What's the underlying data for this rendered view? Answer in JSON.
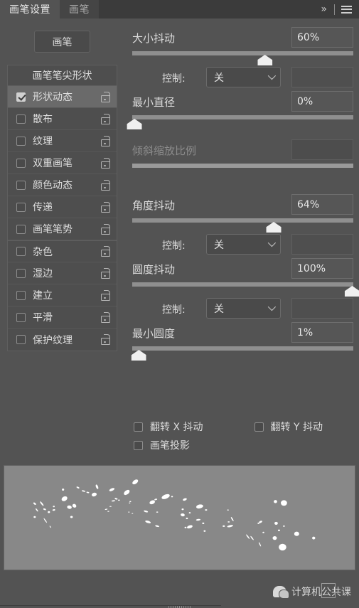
{
  "tabs": {
    "active_label": "画笔设置",
    "inactive_label": "画笔",
    "collapse_label": "»",
    "menu_icon": "hamburger-menu-icon"
  },
  "brush_button": {
    "label": "画笔"
  },
  "sidebar": {
    "header": "画笔笔尖形状",
    "items": [
      {
        "label": "形状动态",
        "checked": true,
        "selected": true,
        "locked": false
      },
      {
        "label": "散布",
        "checked": false,
        "selected": false,
        "locked": false
      },
      {
        "label": "纹理",
        "checked": false,
        "selected": false,
        "locked": false
      },
      {
        "label": "双重画笔",
        "checked": false,
        "selected": false,
        "locked": false
      },
      {
        "label": "颜色动态",
        "checked": false,
        "selected": false,
        "locked": false
      },
      {
        "label": "传递",
        "checked": false,
        "selected": false,
        "locked": false
      },
      {
        "label": "画笔笔势",
        "checked": false,
        "selected": false,
        "locked": false
      },
      {
        "label": "杂色",
        "checked": false,
        "selected": false,
        "locked": false
      },
      {
        "label": "湿边",
        "checked": false,
        "selected": false,
        "locked": false
      },
      {
        "label": "建立",
        "checked": false,
        "selected": false,
        "locked": false
      },
      {
        "label": "平滑",
        "checked": false,
        "selected": false,
        "locked": false
      },
      {
        "label": "保护纹理",
        "checked": false,
        "selected": false,
        "locked": false
      }
    ]
  },
  "settings": {
    "size_jitter": {
      "label": "大小抖动",
      "value": "60%",
      "percent": 60
    },
    "size_control": {
      "label": "控制:",
      "value": "关"
    },
    "min_diameter": {
      "label": "最小直径",
      "value": "0%",
      "percent": 0
    },
    "tilt_scale": {
      "label": "倾斜缩放比例",
      "value": "",
      "percent": 0,
      "disabled": true
    },
    "angle_jitter": {
      "label": "角度抖动",
      "value": "64%",
      "percent": 64
    },
    "angle_control": {
      "label": "控制:",
      "value": "关"
    },
    "roundness_jitter": {
      "label": "圆度抖动",
      "value": "100%",
      "percent": 100
    },
    "roundness_control": {
      "label": "控制:",
      "value": "关"
    },
    "min_roundness": {
      "label": "最小圆度",
      "value": "1%",
      "percent": 3
    }
  },
  "toggles": {
    "flip_x": {
      "label": "翻转 X 抖动",
      "checked": false
    },
    "flip_y": {
      "label": "翻转 Y 抖动",
      "checked": false
    },
    "brush_projection": {
      "label": "画笔投影",
      "checked": false
    }
  },
  "watermark": {
    "text": "计算机公共课",
    "logo": "wechat-icon"
  },
  "colors": {
    "panel_bg": "#535353",
    "tabbar_bg": "#3b3b3b",
    "selection": "#6a6a6a",
    "track": "#8f8f8f",
    "knob": "#f0f0f0",
    "preview_bg": "#888888"
  }
}
